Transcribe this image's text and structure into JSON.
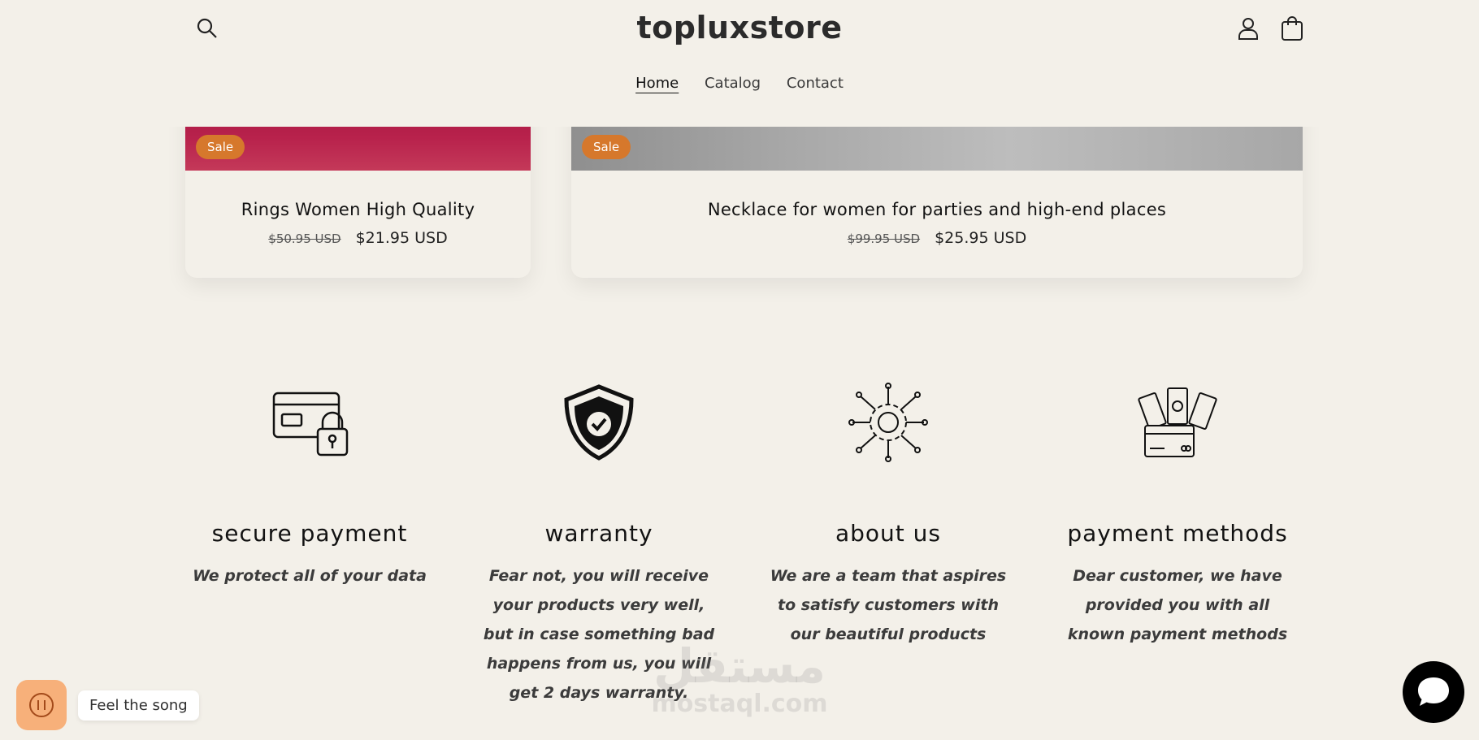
{
  "header": {
    "brand": "topluxstore",
    "icons": {
      "search": "search-icon",
      "account": "user-icon",
      "cart": "cart-icon"
    }
  },
  "nav": [
    {
      "label": "Home",
      "active": true
    },
    {
      "label": "Catalog",
      "active": false
    },
    {
      "label": "Contact",
      "active": false
    }
  ],
  "products": [
    {
      "badge": "Sale",
      "title": "Rings Women High Quality",
      "old_price": "$50.95 USD",
      "price": "$21.95 USD"
    },
    {
      "badge": "Sale",
      "title": "Necklace for women for parties and high-end places",
      "old_price": "$99.95 USD",
      "price": "$25.95 USD"
    }
  ],
  "features": [
    {
      "icon": "card-lock-icon",
      "title": "secure payment",
      "text": "We protect all of your data"
    },
    {
      "icon": "shield-check-icon",
      "title": "warranty",
      "text": "Fear not, you will receive your products very well, but in case something bad happens from us, you will get 2 days warranty."
    },
    {
      "icon": "team-hands-icon",
      "title": "about us",
      "text": "We are a team that aspires to satisfy customers with our beautiful products"
    },
    {
      "icon": "money-card-icon",
      "title": "payment methods",
      "text": "Dear customer, we have provided you with all known payment methods"
    }
  ],
  "music": {
    "label": "Feel the song",
    "icon": "pause-icon"
  },
  "chat": {
    "icon": "chat-bubble-icon"
  },
  "watermark": {
    "arabic": "مستقل",
    "latin": "mostaql.com"
  },
  "colors": {
    "background": "#f3f0e9",
    "sale_badge": "#d6782c",
    "music_button": "#f7b07a"
  }
}
